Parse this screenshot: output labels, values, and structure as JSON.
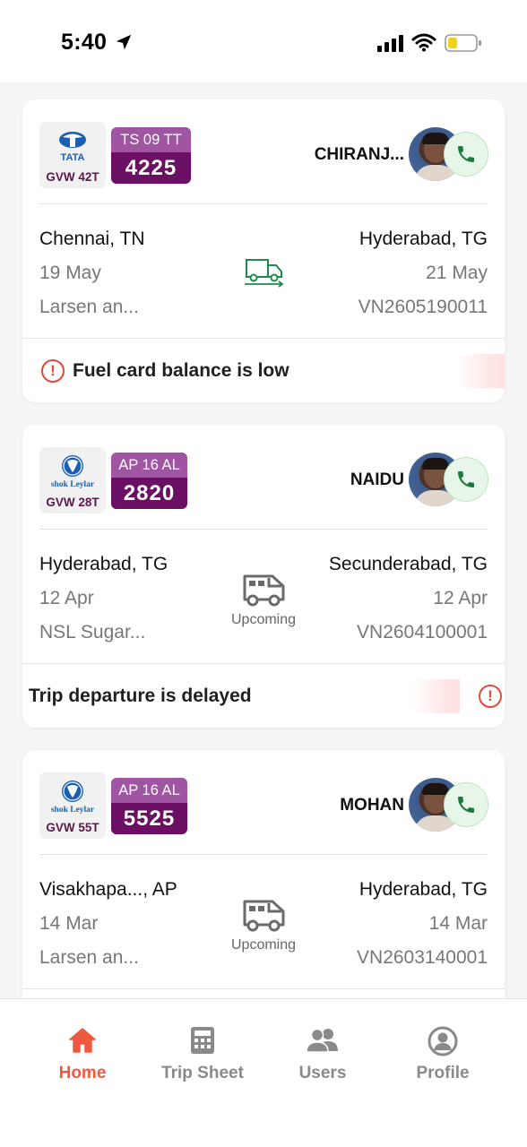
{
  "status_bar": {
    "time": "5:40",
    "icons": [
      "location-arrow-icon",
      "signal-icon",
      "wifi-icon",
      "battery-low-icon"
    ]
  },
  "trips": [
    {
      "brand": "TATA",
      "brand_icon": "tata-logo",
      "gvw": "GVW 42T",
      "plate_state": "TS 09 TT",
      "plate_number": "4225",
      "driver": "CHIRANJ...",
      "origin_city": "Chennai, TN",
      "origin_date": "19 May",
      "consignor": "Larsen an...",
      "dest_city": "Hyderabad, TG",
      "dest_date": "21 May",
      "trip_id": "VN2605190011",
      "status": "",
      "status_icon": "in-transit-truck-icon",
      "alert": "Fuel card balance is low"
    },
    {
      "brand": "shok Leylar",
      "brand_icon": "ashok-leyland-logo",
      "gvw": "GVW 28T",
      "plate_state": "AP 16 AL",
      "plate_number": "2820",
      "driver": "NAIDU",
      "origin_city": "Hyderabad, TG",
      "origin_date": "12 Apr",
      "consignor": "NSL Sugar...",
      "dest_city": "Secunderabad, TG",
      "dest_date": "12 Apr",
      "trip_id": "VN2604100001",
      "status": "Upcoming",
      "status_icon": "truck-icon",
      "alert": "Trip departure is delayed"
    },
    {
      "brand": "shok Leylar",
      "brand_icon": "ashok-leyland-logo",
      "gvw": "GVW 55T",
      "plate_state": "AP 16 AL",
      "plate_number": "5525",
      "driver": "MOHAN",
      "origin_city": "Visakhapa..., AP",
      "origin_date": "14 Mar",
      "consignor": "Larsen an...",
      "dest_city": "Hyderabad, TG",
      "dest_date": "14 Mar",
      "trip_id": "VN2603140001",
      "status": "Upcoming",
      "status_icon": "truck-icon",
      "alert": ""
    }
  ],
  "bottom_nav": [
    {
      "label": "Home",
      "icon": "home-icon",
      "active": true
    },
    {
      "label": "Trip Sheet",
      "icon": "calculator-icon",
      "active": false
    },
    {
      "label": "Users",
      "icon": "users-icon",
      "active": false
    },
    {
      "label": "Profile",
      "icon": "profile-icon",
      "active": false
    }
  ],
  "colors": {
    "accent": "#ee5a3f",
    "plate_dark": "#6a0f63",
    "plate_light": "#a055a3",
    "alert_red": "#e04a3a",
    "transit_green": "#1f8a4c",
    "call_green": "#1e7a3c"
  }
}
